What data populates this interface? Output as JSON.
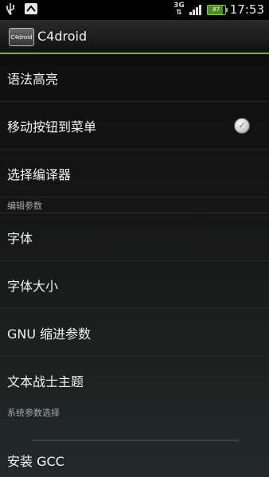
{
  "status_bar": {
    "network": "3G",
    "battery": "87",
    "battery_level": 0.87,
    "time": "17:53",
    "icons": [
      "usb-icon",
      "notification-icon",
      "network-3g-icon",
      "signal-icon",
      "battery-icon"
    ]
  },
  "app_bar": {
    "icon_text": "C4droid",
    "title": "C4droid"
  },
  "settings": {
    "items": [
      {
        "label": "语法高亮"
      },
      {
        "label": "移动按钮到菜单"
      },
      {
        "label": "选择编译器"
      },
      {
        "label": "字体"
      },
      {
        "label": "字体大小"
      },
      {
        "label": "GNU 缩进参数"
      },
      {
        "label": "文本战士主题"
      },
      {
        "label": "安装 GCC"
      }
    ],
    "sections": [
      {
        "label": "编辑参数"
      },
      {
        "label": "系统参数选择"
      }
    ],
    "move_buttons_checked": true
  },
  "colors": {
    "accent": "#7fb043",
    "background": "#0c0c0c",
    "section_text": "#a7a7a7"
  }
}
